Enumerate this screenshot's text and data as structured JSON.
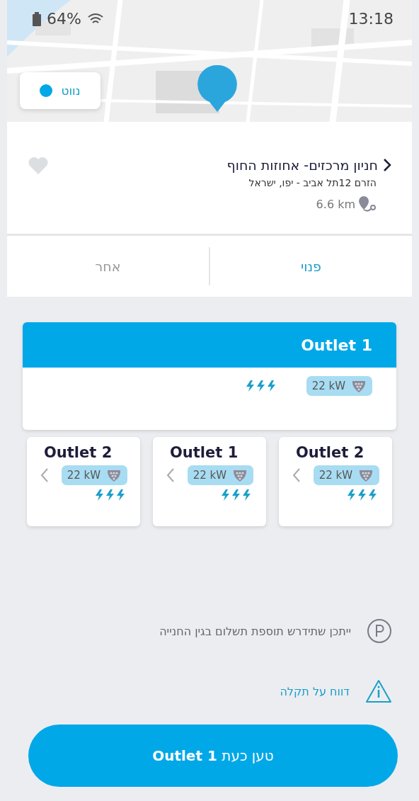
{
  "status_bar": {
    "battery": "64%",
    "time": "13:18"
  },
  "navigate_button": {
    "label": "נווט"
  },
  "station": {
    "name": "חניון מרכזים- אחוזות החוף",
    "address": "הזרם 12תל אביב - יפו, ישראל",
    "distance": "6.6 km",
    "favorite": false
  },
  "tabs": [
    {
      "label": "פנוי",
      "selected": true
    },
    {
      "label": "אחר",
      "selected": false
    }
  ],
  "selected_outlet": {
    "title": "Outlet 1",
    "power": "22 kW"
  },
  "outlets": [
    {
      "title": "Outlet 2",
      "power": "22 kW"
    },
    {
      "title": "Outlet 1",
      "power": "22 kW"
    },
    {
      "title": "Outlet 2",
      "power": "22 kW"
    }
  ],
  "notes": [
    {
      "kind": "parking",
      "text": "ייתכן שתידרש תוספת תשלום בגין החנייה"
    },
    {
      "kind": "report",
      "text": "דווח על תקלה"
    }
  ],
  "action_button": {
    "label": "טען כעת **Outlet 1**"
  }
}
